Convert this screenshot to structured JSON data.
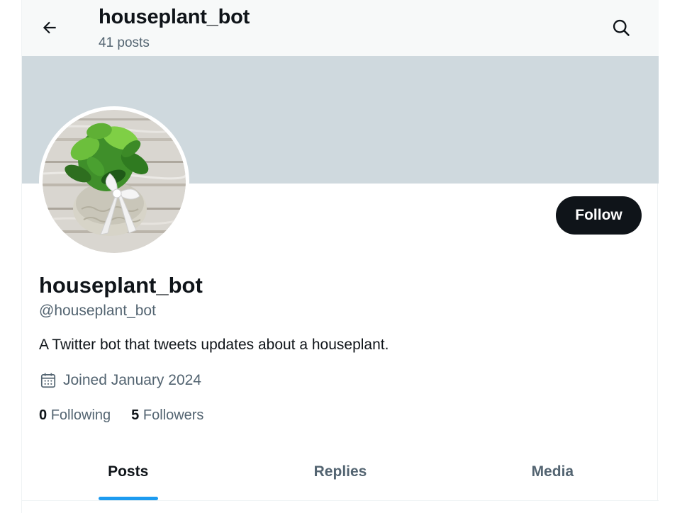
{
  "header": {
    "title": "houseplant_bot",
    "post_count": "41 posts",
    "back_icon": "arrow-left-icon",
    "search_icon": "search-icon"
  },
  "profile": {
    "display_name": "houseplant_bot",
    "handle": "@houseplant_bot",
    "bio": "A Twitter bot that tweets updates about a houseplant.",
    "joined": "Joined January 2024",
    "following_count": "0",
    "following_label": "Following",
    "followers_count": "5",
    "followers_label": "Followers",
    "follow_label": "Follow"
  },
  "tabs": [
    {
      "label": "Posts",
      "active": true
    },
    {
      "label": "Replies",
      "active": false
    },
    {
      "label": "Media",
      "active": false
    }
  ],
  "colors": {
    "banner": "#cfd9de",
    "accent": "#1d9bf0",
    "text_primary": "#0f1419",
    "text_secondary": "#536471",
    "follow_button": "#0f1419"
  }
}
